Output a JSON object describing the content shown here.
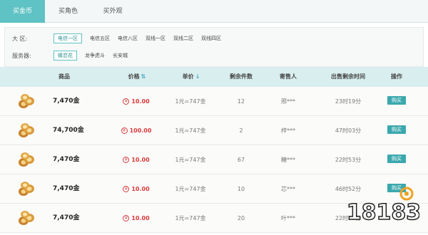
{
  "tabs": [
    {
      "label": "买金币",
      "active": true
    },
    {
      "label": "买角色",
      "active": false
    },
    {
      "label": "买外观",
      "active": false
    }
  ],
  "filter": {
    "region_label": "大  区:",
    "regions": [
      "电信一区",
      "电信五区",
      "电信八区",
      "双线一区",
      "双线二区",
      "双线四区"
    ],
    "selected_region": "电信一区",
    "server_label": "服务器:",
    "servers": [
      "蝶恋花",
      "龙争虎斗",
      "长安城"
    ],
    "selected_server": "蝶恋花"
  },
  "table": {
    "headers": {
      "item": "商品",
      "price": "价格",
      "unit_price": "单价",
      "remaining": "剩余件数",
      "seller": "寄售人",
      "time_left": "出售剩余时间",
      "action": "操作"
    },
    "currency_symbol": "¥",
    "rows": [
      {
        "item": "7,470金",
        "price": "10.00",
        "unit_price": "1元=747金",
        "remaining": "12",
        "seller": "邢***",
        "time_left": "23时19分",
        "action": "购买"
      },
      {
        "item": "74,700金",
        "price": "100.00",
        "unit_price": "1元=747金",
        "remaining": "2",
        "seller": "梓***",
        "time_left": "47时03分",
        "action": "购买"
      },
      {
        "item": "7,470金",
        "price": "10.00",
        "unit_price": "1元=747金",
        "remaining": "67",
        "seller": "糖***",
        "time_left": "22时53分",
        "action": "购买"
      },
      {
        "item": "7,470金",
        "price": "10.00",
        "unit_price": "1元=747金",
        "remaining": "10",
        "seller": "芯***",
        "time_left": "46时52分",
        "action": "购买"
      },
      {
        "item": "7,470金",
        "price": "10.00",
        "unit_price": "1元=747金",
        "remaining": "20",
        "seller": "叶***",
        "time_left": "22时53分",
        "action": "购买"
      }
    ]
  },
  "watermark": {
    "text": "18183"
  },
  "colors": {
    "accent": "#5fc2c4",
    "header_bg": "#d9eeee",
    "price_red": "#d93a3a",
    "buy_button": "#3aa8ad"
  }
}
